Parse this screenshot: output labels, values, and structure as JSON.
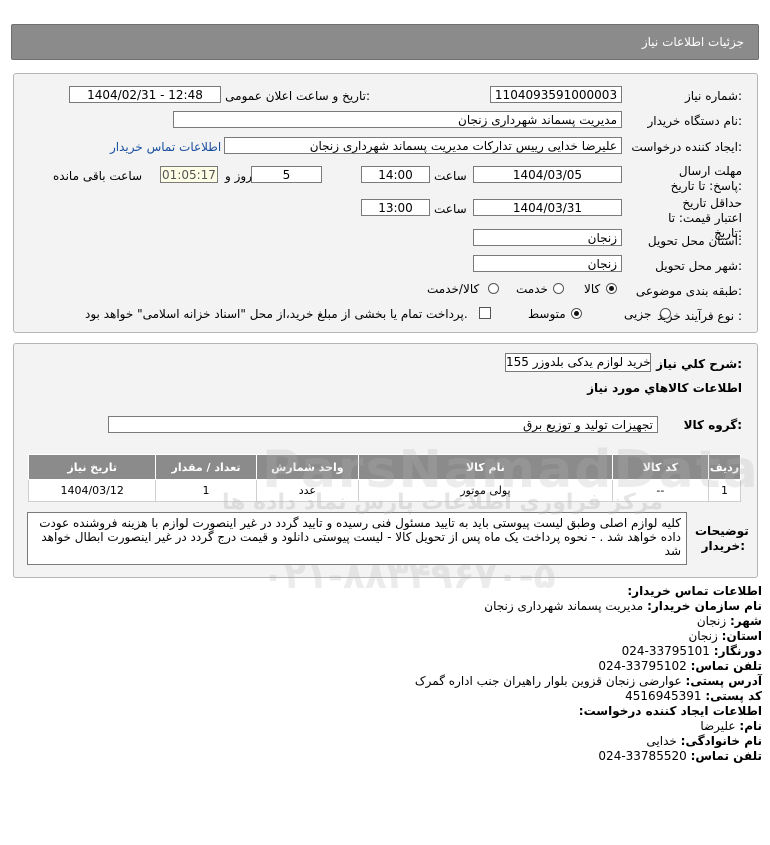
{
  "page": {
    "title": "جزئیات اطلاعات نیاز"
  },
  "info": {
    "need_number_label": "شماره نیاز:",
    "need_number": "1104093591000003",
    "announce_label": "تاریخ و ساعت اعلان عمومی:",
    "announce_value": "1404/02/31 - 12:48",
    "buyer_label": "نام دستگاه خریدار:",
    "buyer_value": "مدیریت پسماند شهرداری زنجان",
    "creator_label": "ایجاد کننده درخواست:",
    "creator_value": "علیرضا خدایی رییس تدارکات مدیریت پسماند شهرداری زنجان",
    "buyer_contact_link": "اطلاعات تماس خریدار",
    "deadline_label": "مهلت ارسال پاسخ: تا تاریخ:",
    "deadline_date": "1404/03/05",
    "time_label": "ساعت",
    "deadline_time": "14:00",
    "days_value": "5",
    "days_label": "روز و",
    "remaining_time": "01:05:17",
    "remaining_label": "ساعت باقی مانده",
    "validity_label": "حداقل تاریخ اعتبار قیمت: تا تاریخ:",
    "validity_date": "1404/03/31",
    "validity_time": "13:00",
    "province_label": "استان محل تحویل:",
    "province_value": "زنجان",
    "city_label": "شهر محل تحویل:",
    "city_value": "زنجان",
    "category_label": "طبقه بندی موضوعی:",
    "category_options": [
      "کالا",
      "خدمت",
      "کالا/خدمت"
    ],
    "category_selected": "کالا",
    "process_label": "نوع فرآیند خرید :",
    "process_options": [
      "جزیی",
      "متوسط"
    ],
    "process_selected": "متوسط",
    "payment_note": "پرداخت تمام یا بخشی از مبلغ خرید،از محل \"اسناد خزانه اسلامی\" خواهد بود."
  },
  "need": {
    "general_label": "شرح کلي نياز:",
    "general_value": "خرید لوازم یدکی بلدوزر 155",
    "goods_info_title": "اطلاعات کالاهاي مورد نياز",
    "goods_group_label": "گروه کالا:",
    "goods_group_value": "تجهیزات تولید و توزیع برق",
    "table": {
      "headers": [
        "ردیف",
        "کد کالا",
        "نام کالا",
        "واحد شمارش",
        "تعداد / مقدار",
        "تاریخ نیاز"
      ],
      "rows": [
        [
          "1",
          "--",
          "پولی موتور",
          "عدد",
          "1",
          "1404/03/12"
        ]
      ]
    },
    "buyer_notes_label": "توضیحات خریدار:",
    "buyer_notes": "کلیه لوازم اصلی وطبق لیست پیوستی باید به تایید مسئول فنی رسیده و تایید گردد در غیر اینصورت لوازم با هزینه فروشنده عودت داده خواهد شد . - نحوه پرداخت یک ماه پس از تحویل کالا - لیست پیوستی دانلود و قیمت درج گردد در غیر اینصورت ابطال خواهد شد"
  },
  "contact": {
    "title": "اطلاعات تماس خریدار:",
    "org_label": "نام سازمان خریدار:",
    "org_value": "مدیریت پسماند شهرداری زنجان",
    "city_label": "شهر:",
    "city_value": "زنجان",
    "province_label": "استان:",
    "province_value": "زنجان",
    "fax_label": "دورنگار:",
    "fax_value": "024-33795101",
    "phone_label": "تلفن تماس:",
    "phone_value": "024-33795102",
    "address_label": "آدرس پستی:",
    "address_value": "عوارضی زنجان قزوین بلوار راهیران جنب اداره گمرک",
    "postal_label": "کد پستی:",
    "postal_value": "4516945391",
    "creator_title": "اطلاعات ایجاد کننده درخواست:",
    "name_label": "نام:",
    "name_value": "علیرضا",
    "family_label": "نام خانوادگی:",
    "family_value": "خدایی",
    "creator_phone_label": "تلفن تماس:",
    "creator_phone_value": "024-33785520"
  },
  "watermark": {
    "brand": "ParsNamadData",
    "tagline": "مرکز فراوری اطلاعات پارس نماد داده ها",
    "phone": "۰۲۱-۸۸۳۴۹۶۷۰-۵"
  }
}
